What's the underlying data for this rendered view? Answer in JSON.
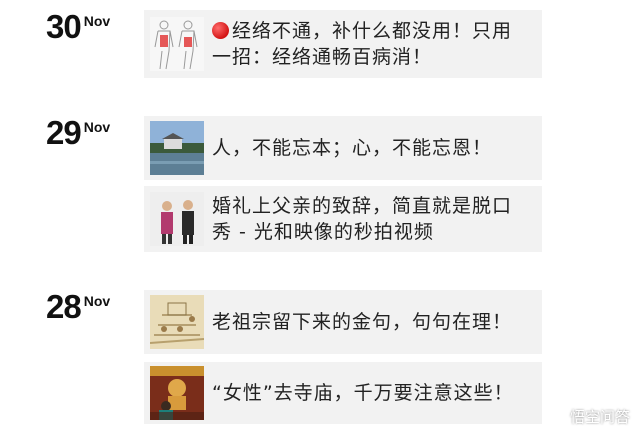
{
  "groups": [
    {
      "day": "30",
      "month": "Nov",
      "items": [
        {
          "thumb": "anatomy-body-icon",
          "title": "经络不通，补什么都没用！只用一招：经络通畅百病消！",
          "line1": "经络不通，补什么都没用！只用",
          "line2": "一招：经络通畅百病消！"
        }
      ]
    },
    {
      "day": "29",
      "month": "Nov",
      "items": [
        {
          "thumb": "landscape-photo",
          "line1": "人，不能忘本；心，不能忘恩！"
        },
        {
          "thumb": "wedding-speech-photo",
          "line1": "婚礼上父亲的致辞，简直就是脱口",
          "line2": "秀 - 光和映像的秒拍视频"
        }
      ]
    },
    {
      "day": "28",
      "month": "Nov",
      "items": [
        {
          "thumb": "ancient-painting-photo",
          "line1": "老祖宗留下来的金句，句句在理！"
        },
        {
          "thumb": "temple-photo",
          "line1": "“女性”去寺庙，千万要注意这些！"
        }
      ]
    }
  ],
  "watermark": {
    "text": "悟空问答",
    "icon": "wukong-logo-icon"
  },
  "colors": {
    "card_bg": "#f2f2f2",
    "text": "#222222",
    "dot": "#d31414"
  }
}
